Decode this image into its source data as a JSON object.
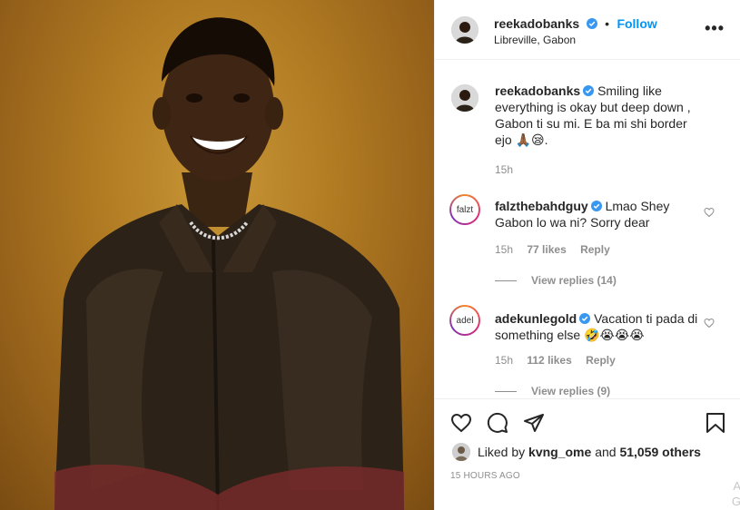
{
  "post": {
    "username": "reekadobanks",
    "follow_label": "Follow",
    "separator": "•",
    "location": "Libreville, Gabon",
    "more_label": "•••"
  },
  "caption": {
    "username": "reekadobanks",
    "text": "Smiling like everything is okay but deep down , Gabon ti su mi. E ba mi shi border ejo 🙏🏾😪.",
    "time": "15h"
  },
  "comments": [
    {
      "username": "falzthebahdguy",
      "avatar_text": "falzt",
      "text": "Lmao Shey Gabon lo wa ni? Sorry dear",
      "time": "15h",
      "likes": "77 likes",
      "reply_label": "Reply",
      "view_replies": "View replies (14)"
    },
    {
      "username": "adekunlegold",
      "avatar_text": "adel",
      "text": "Vacation ti pada di something else 🤣😭😭😭",
      "time": "15h",
      "likes": "112 likes",
      "reply_label": "Reply",
      "view_replies": "View replies (9)"
    }
  ],
  "engagement": {
    "liked_by_prefix": "Liked by",
    "liked_by_user": "kvng_ome",
    "and_label": "and",
    "others": "51,059 others",
    "time_ago": "15 HOURS AGO"
  },
  "edge_text": {
    "line1": "A",
    "line2": "G"
  },
  "colors": {
    "link_blue": "#0095f6",
    "muted": "#8e8e8e",
    "text": "#262626",
    "photo_bg": "#b07a22"
  },
  "icons": [
    "verified-badge-icon",
    "more-options-icon",
    "heart-icon",
    "comment-icon",
    "share-icon",
    "bookmark-icon"
  ]
}
